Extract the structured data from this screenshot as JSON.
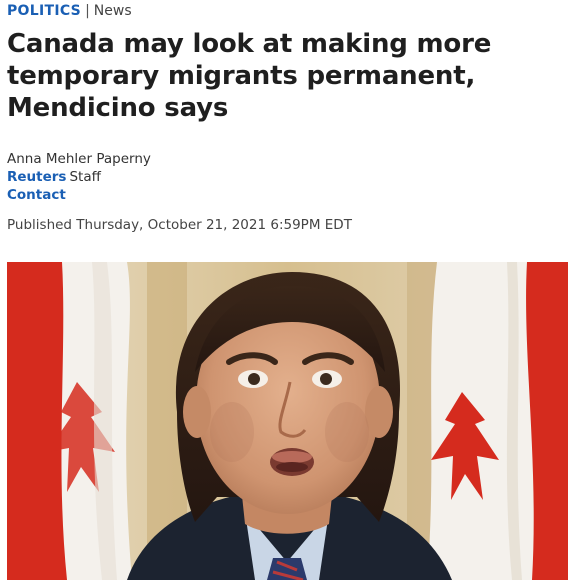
{
  "section": {
    "category": "POLITICS",
    "separator": "|",
    "subcategory": "News"
  },
  "article": {
    "headline": "Canada may look at making more temporary migrants permanent, Mendicino says",
    "author": "Anna Mehler Paperny",
    "organization": "Reuters",
    "role": "Staff",
    "contact_label": "Contact",
    "published": "Published Thursday, October 21, 2021 6:59PM EDT"
  },
  "hero_image": {
    "subject": "man-speaking-in-front-of-canadian-flags"
  },
  "colors": {
    "link": "#1a5fb4",
    "headline": "#1f1f1f",
    "flag_red": "#d52b1e"
  }
}
